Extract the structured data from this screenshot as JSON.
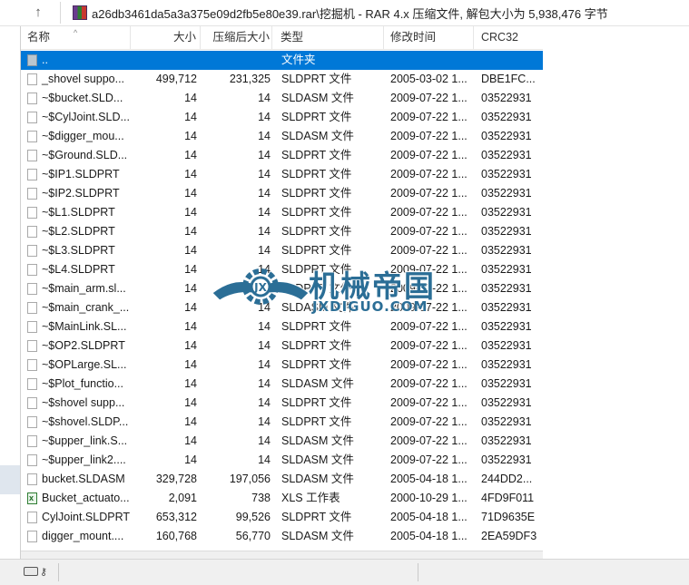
{
  "window": {
    "path_text": "a26db3461da5a3a375e09d2fb5e80e39.rar\\挖掘机 - RAR 4.x 压缩文件, 解包大小为 5,938,476 字节"
  },
  "columns": {
    "name": "名称",
    "size": "大小",
    "packed": "压缩后大小",
    "type": "类型",
    "modified": "修改时间",
    "crc": "CRC32"
  },
  "rows": [
    {
      "name": "..",
      "size": "",
      "packed": "",
      "type": "文件夹",
      "date": "",
      "crc": "",
      "icon": "up-folder-icon",
      "selected": true
    },
    {
      "name": "_shovel suppo...",
      "size": "499,712",
      "packed": "231,325",
      "type": "SLDPRT 文件",
      "date": "2005-03-02 1...",
      "crc": "DBE1FC...",
      "icon": "file-icon"
    },
    {
      "name": "~$bucket.SLD...",
      "size": "14",
      "packed": "14",
      "type": "SLDASM 文件",
      "date": "2009-07-22 1...",
      "crc": "03522931",
      "icon": "file-icon"
    },
    {
      "name": "~$CylJoint.SLD...",
      "size": "14",
      "packed": "14",
      "type": "SLDPRT 文件",
      "date": "2009-07-22 1...",
      "crc": "03522931",
      "icon": "file-icon"
    },
    {
      "name": "~$digger_mou...",
      "size": "14",
      "packed": "14",
      "type": "SLDASM 文件",
      "date": "2009-07-22 1...",
      "crc": "03522931",
      "icon": "file-icon"
    },
    {
      "name": "~$Ground.SLD...",
      "size": "14",
      "packed": "14",
      "type": "SLDPRT 文件",
      "date": "2009-07-22 1...",
      "crc": "03522931",
      "icon": "file-icon"
    },
    {
      "name": "~$IP1.SLDPRT",
      "size": "14",
      "packed": "14",
      "type": "SLDPRT 文件",
      "date": "2009-07-22 1...",
      "crc": "03522931",
      "icon": "file-icon"
    },
    {
      "name": "~$IP2.SLDPRT",
      "size": "14",
      "packed": "14",
      "type": "SLDPRT 文件",
      "date": "2009-07-22 1...",
      "crc": "03522931",
      "icon": "file-icon"
    },
    {
      "name": "~$L1.SLDPRT",
      "size": "14",
      "packed": "14",
      "type": "SLDPRT 文件",
      "date": "2009-07-22 1...",
      "crc": "03522931",
      "icon": "file-icon"
    },
    {
      "name": "~$L2.SLDPRT",
      "size": "14",
      "packed": "14",
      "type": "SLDPRT 文件",
      "date": "2009-07-22 1...",
      "crc": "03522931",
      "icon": "file-icon"
    },
    {
      "name": "~$L3.SLDPRT",
      "size": "14",
      "packed": "14",
      "type": "SLDPRT 文件",
      "date": "2009-07-22 1...",
      "crc": "03522931",
      "icon": "file-icon"
    },
    {
      "name": "~$L4.SLDPRT",
      "size": "14",
      "packed": "14",
      "type": "SLDPRT 文件",
      "date": "2009-07-22 1...",
      "crc": "03522931",
      "icon": "file-icon"
    },
    {
      "name": "~$main_arm.sl...",
      "size": "14",
      "packed": "14",
      "type": "SLDPRT 文件",
      "date": "2009-07-22 1...",
      "crc": "03522931",
      "icon": "file-icon"
    },
    {
      "name": "~$main_crank_...",
      "size": "14",
      "packed": "14",
      "type": "SLDASM 文件",
      "date": "2009-07-22 1...",
      "crc": "03522931",
      "icon": "file-icon"
    },
    {
      "name": "~$MainLink.SL...",
      "size": "14",
      "packed": "14",
      "type": "SLDPRT 文件",
      "date": "2009-07-22 1...",
      "crc": "03522931",
      "icon": "file-icon"
    },
    {
      "name": "~$OP2.SLDPRT",
      "size": "14",
      "packed": "14",
      "type": "SLDPRT 文件",
      "date": "2009-07-22 1...",
      "crc": "03522931",
      "icon": "file-icon"
    },
    {
      "name": "~$OPLarge.SL...",
      "size": "14",
      "packed": "14",
      "type": "SLDPRT 文件",
      "date": "2009-07-22 1...",
      "crc": "03522931",
      "icon": "file-icon"
    },
    {
      "name": "~$Plot_functio...",
      "size": "14",
      "packed": "14",
      "type": "SLDASM 文件",
      "date": "2009-07-22 1...",
      "crc": "03522931",
      "icon": "file-icon"
    },
    {
      "name": "~$shovel supp...",
      "size": "14",
      "packed": "14",
      "type": "SLDPRT 文件",
      "date": "2009-07-22 1...",
      "crc": "03522931",
      "icon": "file-icon"
    },
    {
      "name": "~$shovel.SLDP...",
      "size": "14",
      "packed": "14",
      "type": "SLDPRT 文件",
      "date": "2009-07-22 1...",
      "crc": "03522931",
      "icon": "file-icon"
    },
    {
      "name": "~$upper_link.S...",
      "size": "14",
      "packed": "14",
      "type": "SLDASM 文件",
      "date": "2009-07-22 1...",
      "crc": "03522931",
      "icon": "file-icon"
    },
    {
      "name": "~$upper_link2....",
      "size": "14",
      "packed": "14",
      "type": "SLDASM 文件",
      "date": "2009-07-22 1...",
      "crc": "03522931",
      "icon": "file-icon"
    },
    {
      "name": "bucket.SLDASM",
      "size": "329,728",
      "packed": "197,056",
      "type": "SLDASM 文件",
      "date": "2005-04-18 1...",
      "crc": "244DD2...",
      "icon": "file-icon"
    },
    {
      "name": "Bucket_actuato...",
      "size": "2,091",
      "packed": "738",
      "type": "XLS 工作表",
      "date": "2000-10-29 1...",
      "crc": "4FD9F011",
      "icon": "excel-icon"
    },
    {
      "name": "CylJoint.SLDPRT",
      "size": "653,312",
      "packed": "99,526",
      "type": "SLDPRT 文件",
      "date": "2005-04-18 1...",
      "crc": "71D9635E",
      "icon": "file-icon"
    },
    {
      "name": "digger_mount....",
      "size": "160,768",
      "packed": "56,770",
      "type": "SLDASM 文件",
      "date": "2005-04-18 1...",
      "crc": "2EA59DF3",
      "icon": "file-icon"
    }
  ],
  "watermark": {
    "cn": "机械帝国",
    "en": "JXDIGUO.COM"
  },
  "colors": {
    "selection": "#0078d7",
    "watermark": "#2b6e96"
  }
}
